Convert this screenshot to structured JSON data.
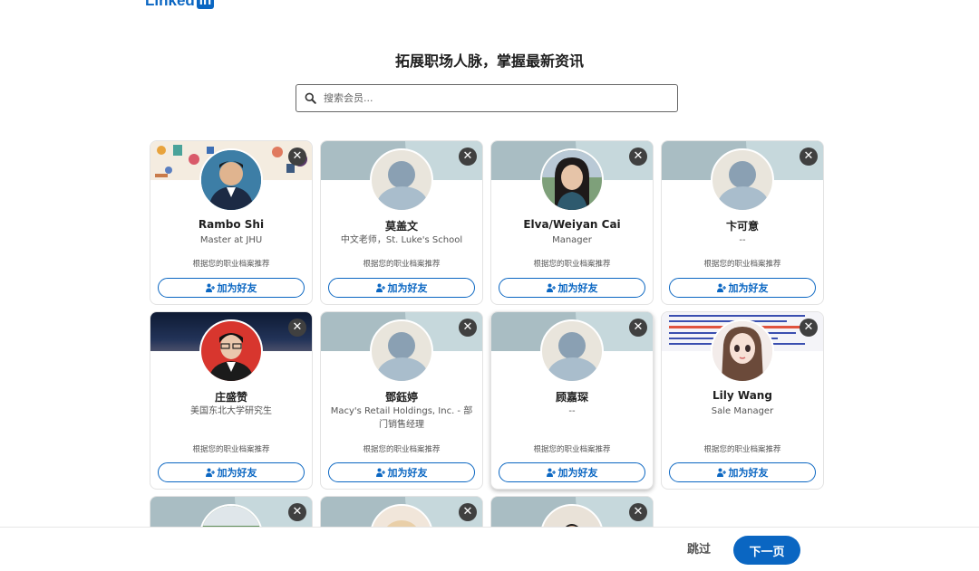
{
  "brand": {
    "logo_text": "Linked",
    "logo_badge": "in",
    "color": "#0a66c2"
  },
  "page": {
    "title": "拓展职场人脉，掌握最新资讯"
  },
  "search": {
    "placeholder": "搜索会员..."
  },
  "cards": [
    {
      "name": "Rambo Shi",
      "headline": "Master at JHU",
      "reason": "根据您的职业档案推荐",
      "button": "加为好友"
    },
    {
      "name": "莫盖文",
      "headline": "中文老师，St. Luke's School",
      "reason": "根据您的职业档案推荐",
      "button": "加为好友"
    },
    {
      "name": "Elva/Weiyan Cai",
      "headline": "Manager",
      "reason": "根据您的职业档案推荐",
      "button": "加为好友"
    },
    {
      "name": "卞可意",
      "headline": "--",
      "reason": "根据您的职业档案推荐",
      "button": "加为好友"
    },
    {
      "name": "庄盛赞",
      "headline": "美国东北大学研究生",
      "reason": "根据您的职业档案推荐",
      "button": "加为好友"
    },
    {
      "name": "鄧鈺婷",
      "headline": "Macy's Retail Holdings, Inc. - 部门销售经理",
      "reason": "根据您的职业档案推荐",
      "button": "加为好友"
    },
    {
      "name": "顾嘉琛",
      "headline": "--",
      "reason": "根据您的职业档案推荐",
      "button": "加为好友"
    },
    {
      "name": "Lily Wang",
      "headline": "Sale Manager",
      "reason": "根据您的职业档案推荐",
      "button": "加为好友"
    }
  ],
  "footer": {
    "skip": "跳过",
    "next": "下一页"
  }
}
